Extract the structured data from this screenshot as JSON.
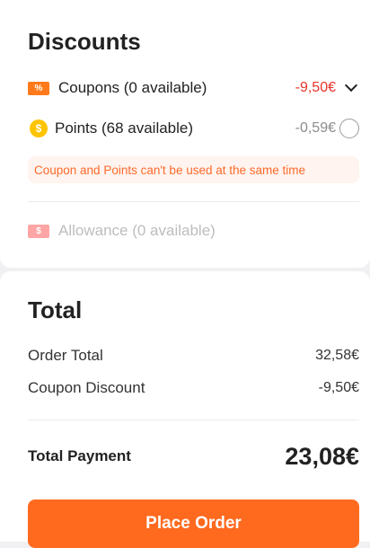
{
  "discounts": {
    "title": "Discounts",
    "coupons": {
      "icon_text": "%",
      "label": "Coupons (0 available)",
      "value": "-9,50€"
    },
    "points": {
      "icon_text": "$",
      "label": "Points (68 available)",
      "value": "-0,59€"
    },
    "notice": "Coupon and Points can't be used at the same time",
    "allowance": {
      "icon_text": "$",
      "label": "Allowance (0 available)"
    }
  },
  "total": {
    "title": "Total",
    "order_total_label": "Order Total",
    "order_total_value": "32,58€",
    "coupon_discount_label": "Coupon Discount",
    "coupon_discount_value": "-9,50€",
    "payment_label": "Total Payment",
    "payment_value": "23,08€"
  },
  "actions": {
    "place_order": "Place Order"
  },
  "colors": {
    "accent": "#ff6a1f",
    "discount_red": "#e8332a",
    "muted": "#9a9a9a",
    "notice_text": "#ff6a2b",
    "notice_bg": "#fff4ef",
    "coin_yellow": "#ffc400"
  }
}
